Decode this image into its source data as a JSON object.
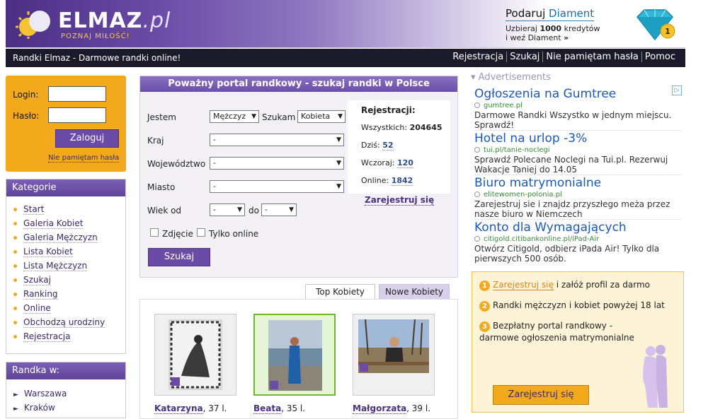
{
  "header": {
    "logo_main": "ELMAZ",
    "logo_tld": ".pl",
    "logo_sub": "POZNAJ MIŁOŚĆ!",
    "promo_title_prefix": "Podaruj",
    "promo_title_accent": "Diament",
    "promo_line1_pre": "Uzbieraj",
    "promo_line1_num": "1000",
    "promo_line1_post": "kredytów",
    "promo_line2": "i weź Diament",
    "promo_arrow": "»",
    "diamond_badge": "1"
  },
  "nav": {
    "tagline": "Randki Elmaz - Darmowe randki online!",
    "links": [
      "Rejestracja",
      "Szukaj",
      "Nie pamiętam hasła",
      "Pomoc"
    ]
  },
  "login": {
    "login_label": "Login:",
    "password_label": "Hasło:",
    "submit": "Zaloguj",
    "forgot": "Nie pamiętam hasła"
  },
  "categories": {
    "title": "Kategorie",
    "items": [
      "Start",
      "Galeria Kobiet",
      "Galeria Mężczyzn",
      "Lista Kobiet",
      "Lista Mężczyzn",
      "Szukaj",
      "Ranking",
      "Online",
      "Obchodzą urodziny",
      "Rejestracja"
    ]
  },
  "randka": {
    "title": "Randka w:",
    "items": [
      "Warszawa",
      "Kraków"
    ]
  },
  "search": {
    "title": "Poważny portal randkowy - szukaj randki w Polsce",
    "jestem_label": "Jestem",
    "jestem_value": "Mężczyz",
    "szukam_label": "Szukam",
    "szukam_value": "Kobieta",
    "kraj_label": "Kraj",
    "kraj_value": "-",
    "woj_label": "Województwo",
    "woj_value": "-",
    "miasto_label": "Miasto",
    "miasto_value": "-",
    "wiek_label": "Wiek od",
    "wiek_from": "-",
    "do_label": "do",
    "wiek_to": "-",
    "photo_label": "Zdjęcie",
    "online_label": "Tylko online",
    "submit": "Szukaj"
  },
  "stats": {
    "title": "Rejestracji:",
    "all_label": "Wszystkich:",
    "all_value": "204645",
    "today_label": "Dziś:",
    "today_value": "52",
    "yesterday_label": "Wczoraj:",
    "yesterday_value": "120",
    "online_label": "Online:",
    "online_value": "1842",
    "register_link": "Zarejestruj się"
  },
  "tabs": [
    "Top Kobiety",
    "Nowe Kobiety"
  ],
  "gallery": [
    {
      "name": "Katarzyna",
      "age": ", 37 l."
    },
    {
      "name": "Beata",
      "age": ", 35 l."
    },
    {
      "name": "Małgorzata",
      "age": ", 39 l."
    }
  ],
  "ads": {
    "heading": "Advertisements",
    "choice_icon": "▷",
    "items": [
      {
        "title": "Ogłoszenia na Gumtree",
        "url": "gumtree.pl",
        "desc": "Darmowe Randki Wszystko w jednym miejscu. Sprawdź!"
      },
      {
        "title": "Hotel na urlop -3%",
        "url": "tui.pl/tanie-noclegi",
        "desc": "Sprawdź Polecane Noclegi na Tui.pl. Rezerwuj Wakacje Taniej do 14.05"
      },
      {
        "title": "Biuro matrymonialne",
        "url": "elitewomen-polonia.pl",
        "desc": "Zarejestruj sie i znajdz przyszłego meża przez nasze biuro w Niemczech"
      },
      {
        "title": "Konto dla Wymagających",
        "url": "citigold.citibankonline.pl/iPad-Air",
        "desc": "Otwórz Citigold, odbierz iPada Air! Tylko dla pierwszych 500 osób."
      }
    ]
  },
  "benefits": {
    "item1_link": "Zarejestruj się",
    "item1_rest": " i załóż profil za darmo",
    "item2": "Randki mężczyzn i kobiet powyżej 18 lat",
    "item3": "Bezpłatny portal randkowy - darmowe ogłoszenia matrymonialne",
    "n1": "1",
    "n2": "2",
    "n3": "3",
    "cta": "Zarejestruj się"
  },
  "colors": {
    "brand_purple": "#6a4ba6",
    "accent_orange": "#f3a91c",
    "nav_dark": "#1b1a2b",
    "ad_link_blue": "#1c59b5"
  }
}
